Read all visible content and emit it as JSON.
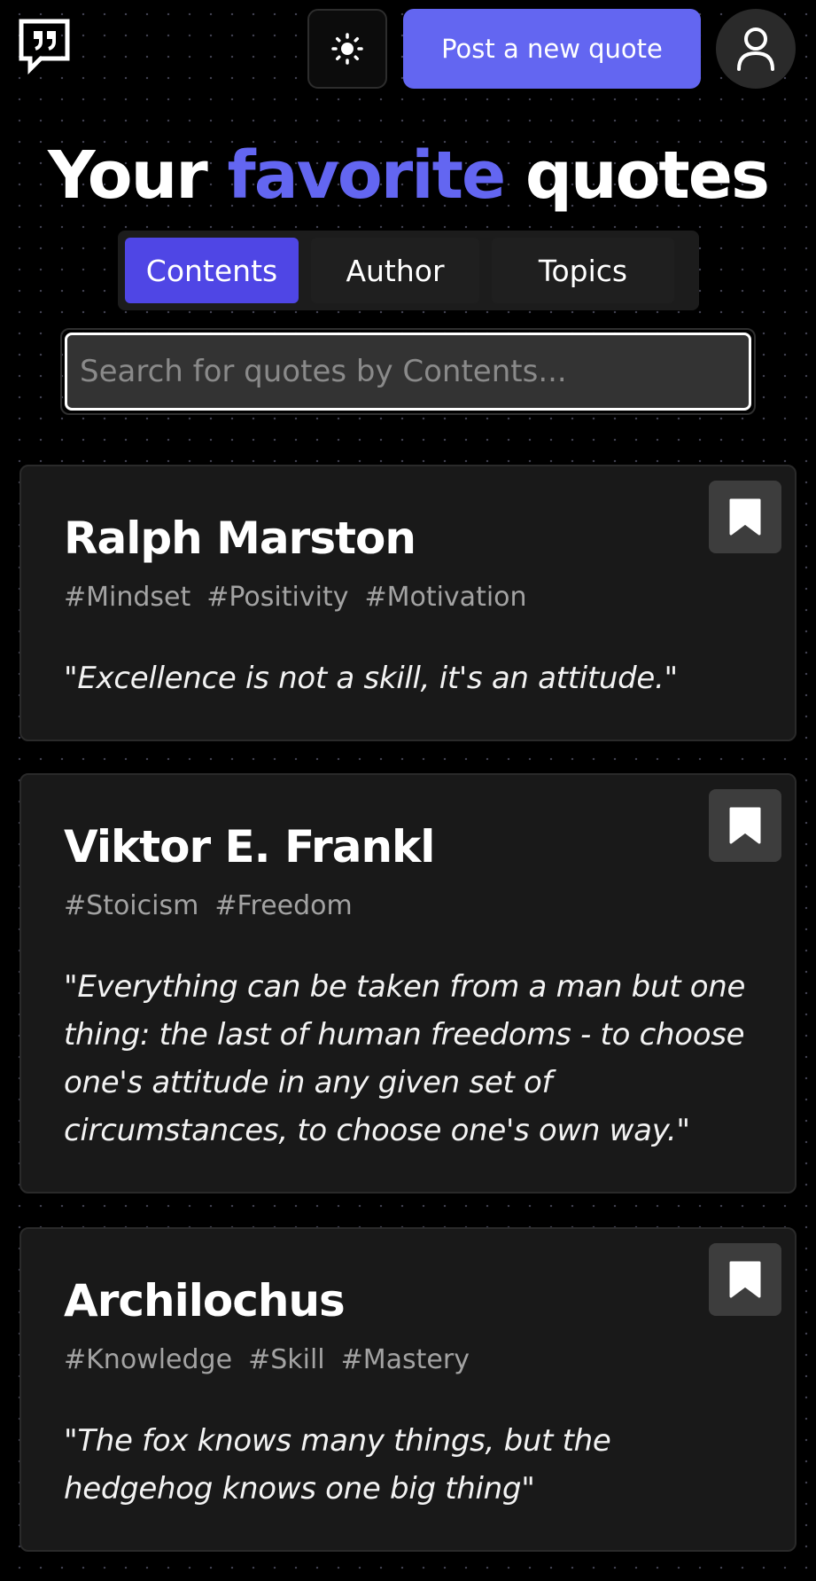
{
  "header": {
    "logo_icon": "quote-bubble-icon",
    "theme_icon": "sun-icon",
    "post_button_label": "Post a new quote",
    "avatar_icon": "user-icon"
  },
  "title": {
    "part1": "Your ",
    "highlight": "favorite",
    "part2": " quotes"
  },
  "tabs": [
    {
      "label": "Contents",
      "active": true
    },
    {
      "label": "Author",
      "active": false
    },
    {
      "label": "Topics",
      "active": false
    }
  ],
  "search": {
    "placeholder": "Search for quotes by Contents...",
    "value": ""
  },
  "quotes": [
    {
      "author": "Ralph Marston",
      "tags": [
        "#Mindset",
        "#Positivity",
        "#Motivation"
      ],
      "text": "\"Excellence is not a skill, it's an attitude.\""
    },
    {
      "author": "Viktor E. Frankl",
      "tags": [
        "#Stoicism",
        "#Freedom"
      ],
      "text": "\"Everything can be taken from a man but one thing: the last of human freedoms - to choose one's attitude in any given set of circumstances, to choose one's own way.\""
    },
    {
      "author": "Archilochus",
      "tags": [
        "#Knowledge",
        "#Skill",
        "#Mastery"
      ],
      "text": "\"The fox knows many things, but the hedgehog knows one big thing\""
    }
  ],
  "colors": {
    "accent": "#6366f1",
    "active_tab": "#4f46e5",
    "card_bg": "#191919",
    "page_bg": "#000000"
  }
}
